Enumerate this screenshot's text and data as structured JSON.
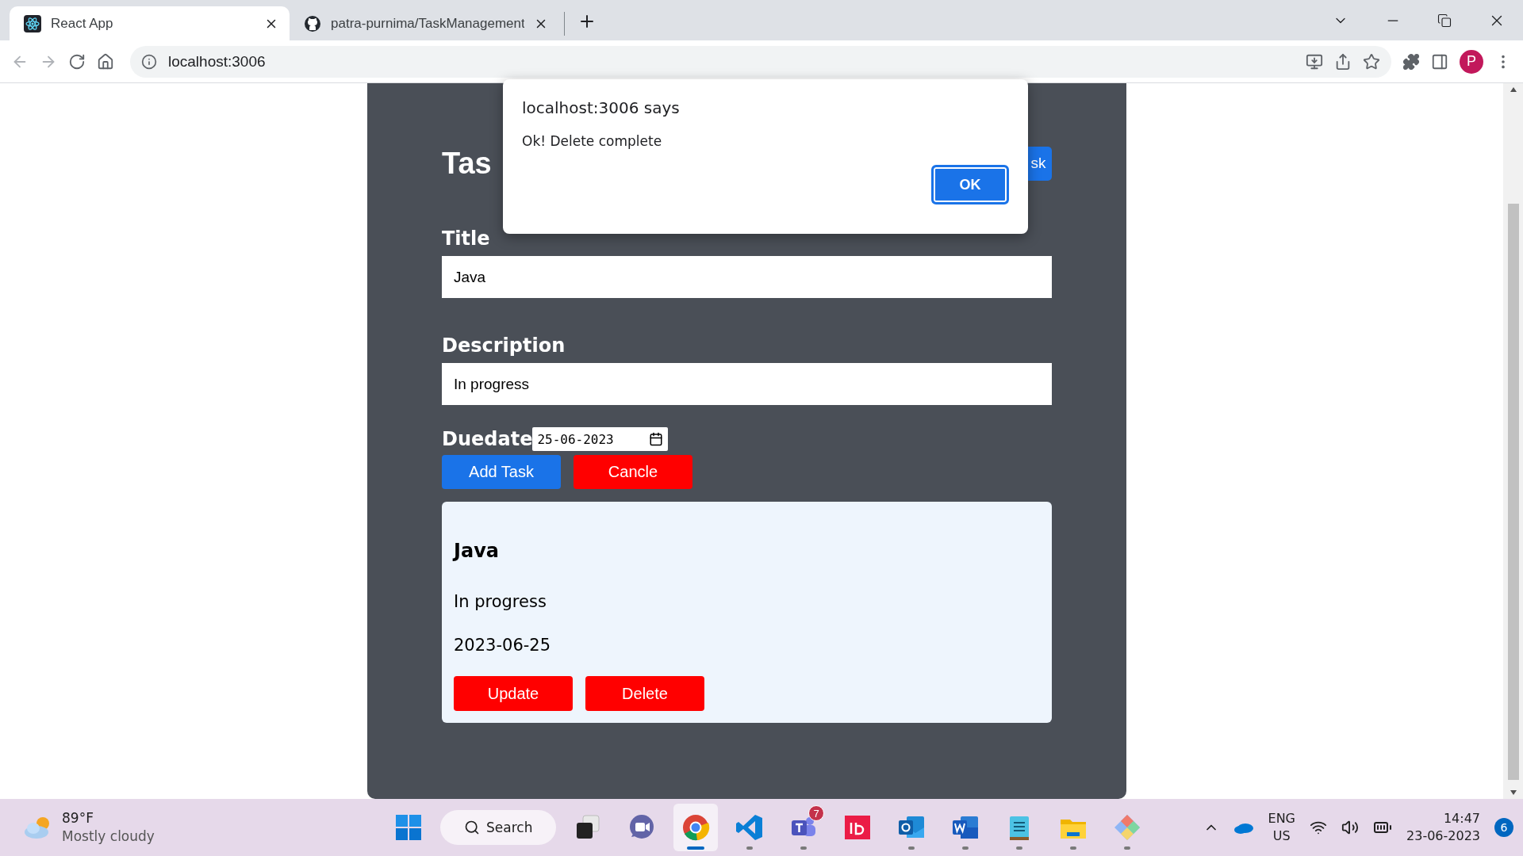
{
  "browser": {
    "tabs": [
      {
        "title": "React App",
        "selected": true,
        "kind": "react"
      },
      {
        "title": "patra-purnima/TaskManagement",
        "selected": false,
        "kind": "github"
      }
    ],
    "address": "localhost:3006",
    "profile": "P"
  },
  "dialog": {
    "title": "localhost:3006 says",
    "message": "Ok! Delete complete",
    "button": "OK"
  },
  "app": {
    "heading": "Tas",
    "top_button": "sk",
    "fields": [
      {
        "label": "Title",
        "value": "Java"
      },
      {
        "label": "Description",
        "value": "In progress"
      }
    ],
    "duedate": {
      "label": "Duedate",
      "value": "25-06-2023"
    },
    "buttons": [
      {
        "label": "Add Task",
        "kind": "primary"
      },
      {
        "label": "Cancle",
        "kind": "danger"
      }
    ],
    "tasks": [
      {
        "title": "Java",
        "description": "In progress",
        "due": "2023-06-25",
        "buttons": [
          "Update",
          "Delete"
        ]
      }
    ]
  },
  "taskbar": {
    "weather": {
      "temp": "89°F",
      "condition": "Mostly cloudy"
    },
    "search": "Search",
    "apps": [
      {
        "kind": "windows",
        "running": false,
        "selected": false
      },
      {
        "kind": "search"
      },
      {
        "kind": "taskview",
        "running": false,
        "selected": false
      },
      {
        "kind": "chat",
        "running": false,
        "selected": false
      },
      {
        "kind": "chrome",
        "running": true,
        "selected": true
      },
      {
        "kind": "vscode",
        "running": true,
        "selected": false
      },
      {
        "kind": "teams",
        "running": true,
        "selected": false,
        "badge": "7"
      },
      {
        "kind": "indesign",
        "running": false,
        "selected": false
      },
      {
        "kind": "outlook",
        "running": true,
        "selected": false
      },
      {
        "kind": "word",
        "running": true,
        "selected": false
      },
      {
        "kind": "notepad",
        "running": true,
        "selected": false
      },
      {
        "kind": "explorer",
        "running": true,
        "selected": false
      },
      {
        "kind": "gitapp",
        "running": true,
        "selected": false
      }
    ],
    "language": [
      "ENG",
      "US"
    ],
    "time": "14:47",
    "date": "23-06-2023",
    "notifications": "6"
  }
}
